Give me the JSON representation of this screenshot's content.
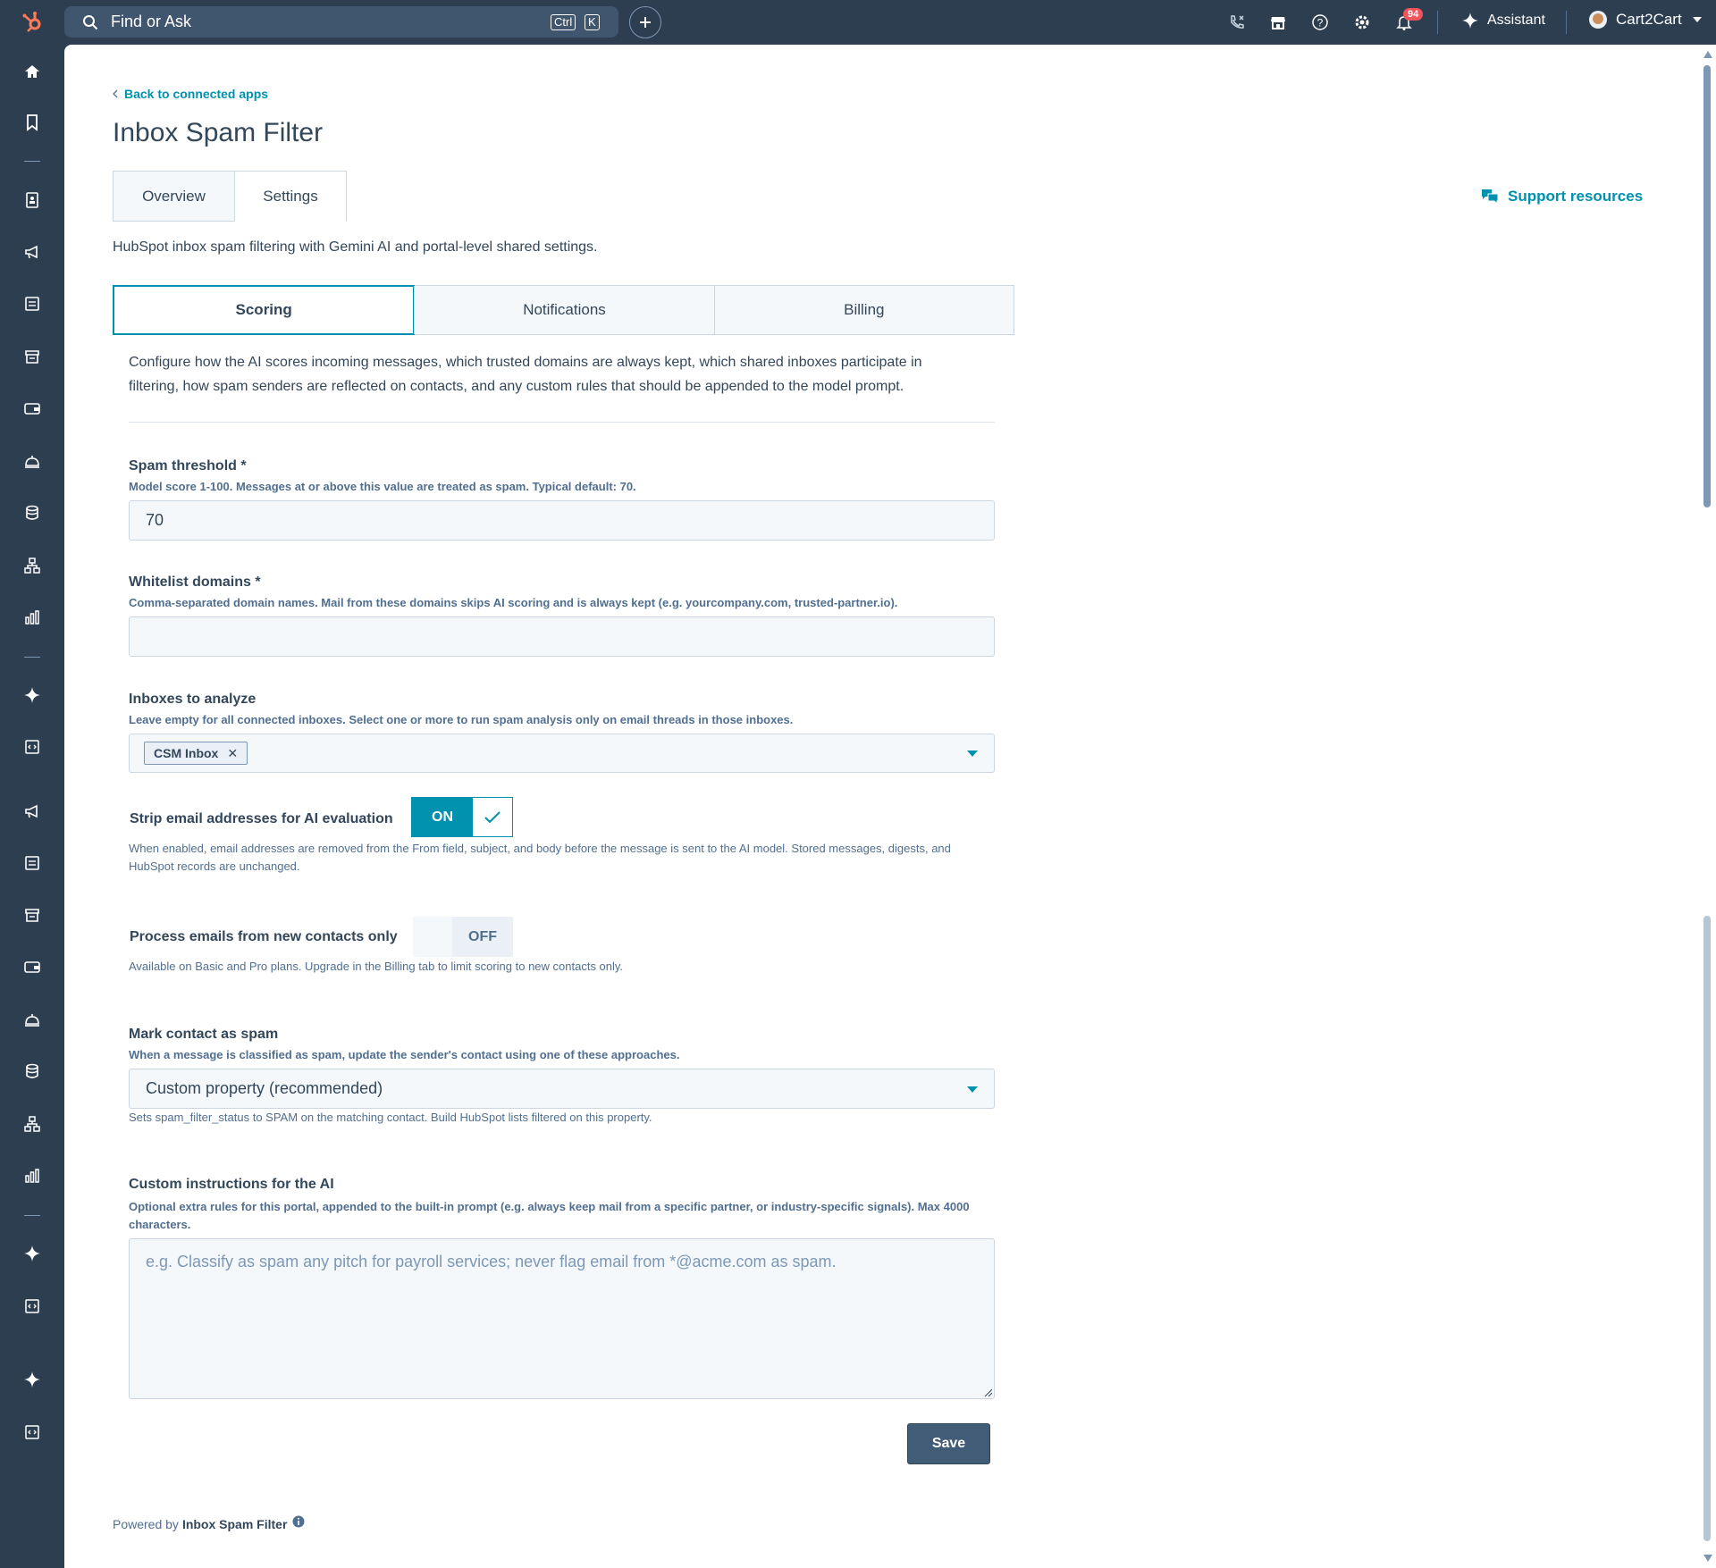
{
  "topbar": {
    "search_placeholder": "Find or Ask",
    "shortcut_ctrl": "Ctrl",
    "shortcut_key": "K",
    "notification_count": "94",
    "assistant_label": "Assistant",
    "account_name": "Cart2Cart",
    "icons": [
      "hubspot-logo",
      "search-icon",
      "plus-icon",
      "calling-icon",
      "marketplace-icon",
      "help-icon",
      "settings-icon",
      "bell-icon",
      "sparkle-icon",
      "chevron-down-icon"
    ]
  },
  "sidenav": {
    "icons": [
      "home-icon",
      "bookmark-icon",
      "contacts-icon",
      "megaphone-icon",
      "content-icon",
      "commerce-icon",
      "wallet-icon",
      "service-icon",
      "database-icon",
      "automation-icon",
      "reports-icon",
      "sparkle-icon",
      "code-icon"
    ]
  },
  "page": {
    "back_link": "Back to connected apps",
    "title": "Inbox Spam Filter",
    "tabs": [
      {
        "label": "Overview",
        "active": false
      },
      {
        "label": "Settings",
        "active": true
      }
    ],
    "support_link": "Support resources",
    "app_description": "HubSpot inbox spam filtering with Gemini AI and portal-level shared settings."
  },
  "settings": {
    "subtabs": [
      {
        "label": "Scoring",
        "active": true
      },
      {
        "label": "Notifications",
        "active": false
      },
      {
        "label": "Billing",
        "active": false
      }
    ],
    "intro": "Configure how the AI scores incoming messages, which trusted domains are always kept, which shared inboxes participate in filtering, how spam senders are reflected on contacts, and any custom rules that should be appended to the model prompt.",
    "spam_threshold": {
      "label": "Spam threshold *",
      "help": "Model score 1-100. Messages at or above this value are treated as spam. Typical default: 70.",
      "value": "70"
    },
    "whitelist": {
      "label": "Whitelist domains *",
      "help": "Comma-separated domain names. Mail from these domains skips AI scoring and is always kept (e.g. yourcompany.com, trusted-partner.io).",
      "value": ""
    },
    "inboxes": {
      "label": "Inboxes to analyze",
      "help": "Leave empty for all connected inboxes. Select one or more to run spam analysis only on email threads in those inboxes.",
      "selected": [
        "CSM Inbox"
      ]
    },
    "strip_emails": {
      "label": "Strip email addresses for AI evaluation",
      "state": "ON",
      "help": "When enabled, email addresses are removed from the From field, subject, and body before the message is sent to the AI model. Stored messages, digests, and HubSpot records are unchanged."
    },
    "new_contacts_only": {
      "label": "Process emails from new contacts only",
      "state": "OFF",
      "help": "Available on Basic and Pro plans. Upgrade in the Billing tab to limit scoring to new contacts only."
    },
    "mark_contact": {
      "label": "Mark contact as spam",
      "help": "When a message is classified as spam, update the sender's contact using one of these approaches.",
      "selected": "Custom property (recommended)",
      "note": "Sets spam_filter_status to SPAM on the matching contact. Build HubSpot lists filtered on this property."
    },
    "custom_instructions": {
      "label": "Custom instructions for the AI",
      "help": "Optional extra rules for this portal, appended to the built-in prompt (e.g. always keep mail from a specific partner, or industry-specific signals). Max 4000 characters.",
      "placeholder": "e.g. Classify as spam any pitch for payroll services; never flag email from *@acme.com as spam."
    },
    "save_label": "Save"
  },
  "footer": {
    "powered_prefix": "Powered by",
    "powered_brand": "Inbox Spam Filter"
  },
  "colors": {
    "nav_bg": "#2d3e50",
    "accent": "#0091ae",
    "text": "#33475b",
    "save_bg": "#425b76",
    "badge": "#f2545b"
  }
}
